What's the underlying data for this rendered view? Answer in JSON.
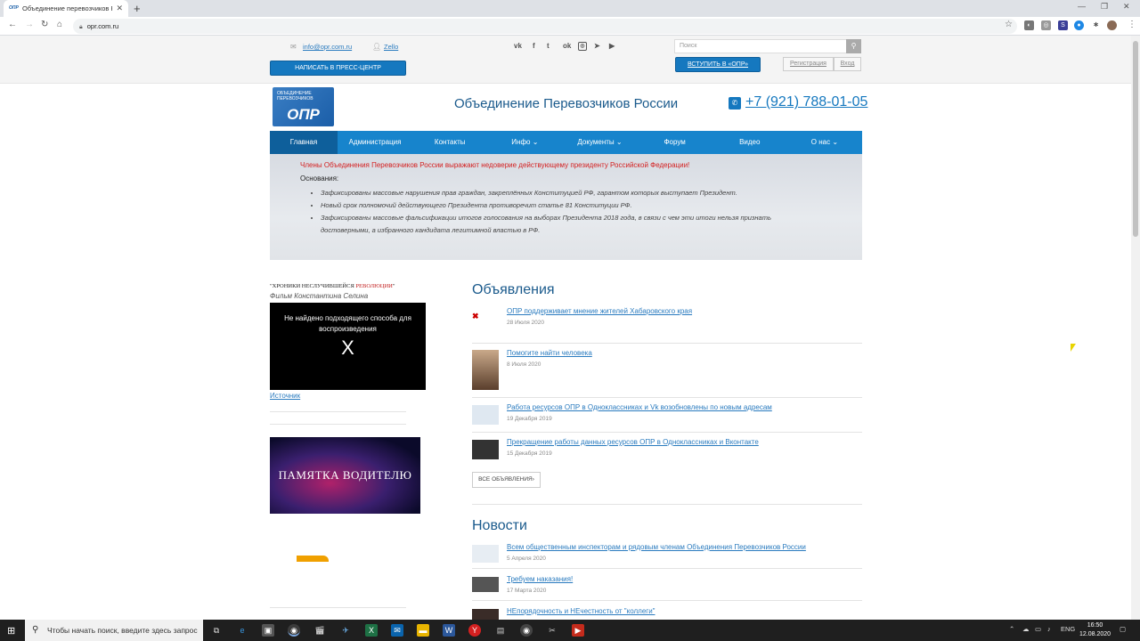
{
  "browser": {
    "tab_title": "Объединение перевозчиков Р...",
    "tab_favicon_text": "ОПР",
    "url": "opr.com.ru"
  },
  "topbar": {
    "email": "info@opr.com.ru",
    "zello": "Zello",
    "press_button": "НАПИСАТЬ В ПРЕСС-ЦЕНТР",
    "search_placeholder": "Поиск",
    "join_button": "ВСТУПИТЬ В «ОПР»",
    "register": "Регистрация",
    "login": "Вход",
    "social_icons": [
      "vk-icon",
      "facebook-icon",
      "twitter-icon",
      "odnoklassniki-icon",
      "instagram-icon",
      "telegram-icon",
      "youtube-icon"
    ]
  },
  "header": {
    "logo_text": "ОПР",
    "logo_small": "ОБЪЕДИНЕНИЕ ПЕРЕВОЗЧИКОВ",
    "title": "Объединение Перевозчиков России",
    "phone": "+7 (921) 788-01-05"
  },
  "menu": [
    {
      "label": "Главная",
      "active": true
    },
    {
      "label": "Администрация"
    },
    {
      "label": "Контакты"
    },
    {
      "label": "Инфо ⌄"
    },
    {
      "label": "Документы ⌄"
    },
    {
      "label": "Форум"
    },
    {
      "label": "Видео"
    },
    {
      "label": "О нас ⌄"
    }
  ],
  "banner": {
    "headline": "Члены Объединения Перевозчиков России выражают недоверие действующему президенту Российской Федерации!",
    "basis_label": "Основания:",
    "reasons": [
      "Зафиксированы массовые нарушения прав граждан, закреплённых Конституцией РФ, гарантом которых выступает Президент.",
      "Новый срок полномочий действующего Президента противоречит статье 81 Конституции РФ.",
      "Зафиксированы массовые фальсификации итогов голосования на выборах Президента 2018 года, в связи с чем эти итоги нельзя признать достоверными, а избранного кандидата легитимной властью в РФ."
    ]
  },
  "sidebar": {
    "chronicle_prefix": "\"ХРОНИКИ НЕСЛУЧИВШЕЙСЯ ",
    "chronicle_red": "РЕВОЛЮЦИИ",
    "chronicle_suffix": "\"",
    "film": "Фильм Константина Селина",
    "video_message": "Не найдено подходящего способа для воспроизведения",
    "video_x": "X",
    "source_link": "Источник",
    "pamyatka": "ПАМЯТКА ВОДИТЕЛЮ"
  },
  "announcements": {
    "heading": "Объявления",
    "items": [
      {
        "title": "ОПР поддерживает мнение жителей Хабаровского края",
        "date": "28 Июля 2020"
      },
      {
        "title": "Помогите найти человека",
        "date": "8 Июля 2020"
      },
      {
        "title": "Работа ресурсов ОПР в Одноклассниках и Vk возобновлены по новым адресам",
        "date": "19 Декабря 2019"
      },
      {
        "title": "Прекращение работы данных ресурсов ОПР в Одноклассниках и Вконтакте",
        "date": "15 Декабря 2019"
      }
    ],
    "all_button": "ВСЕ ОБЪЯВЛЕНИЯ›"
  },
  "news": {
    "heading": "Новости",
    "items": [
      {
        "title": "Всем общественным инспекторам и рядовым членам Объединения Перевозчиков России",
        "date": "5 Апреля 2020"
      },
      {
        "title": "Требуем наказания!",
        "date": "17 Марта 2020"
      },
      {
        "title": "НЕпорядочность и НЕчестность от \"коллеги\"",
        "date": ""
      }
    ]
  },
  "taskbar": {
    "search_placeholder": "Чтобы начать поиск, введите здесь запрос",
    "lang": "ENG",
    "time": "16:50",
    "date": "12.08.2020"
  }
}
